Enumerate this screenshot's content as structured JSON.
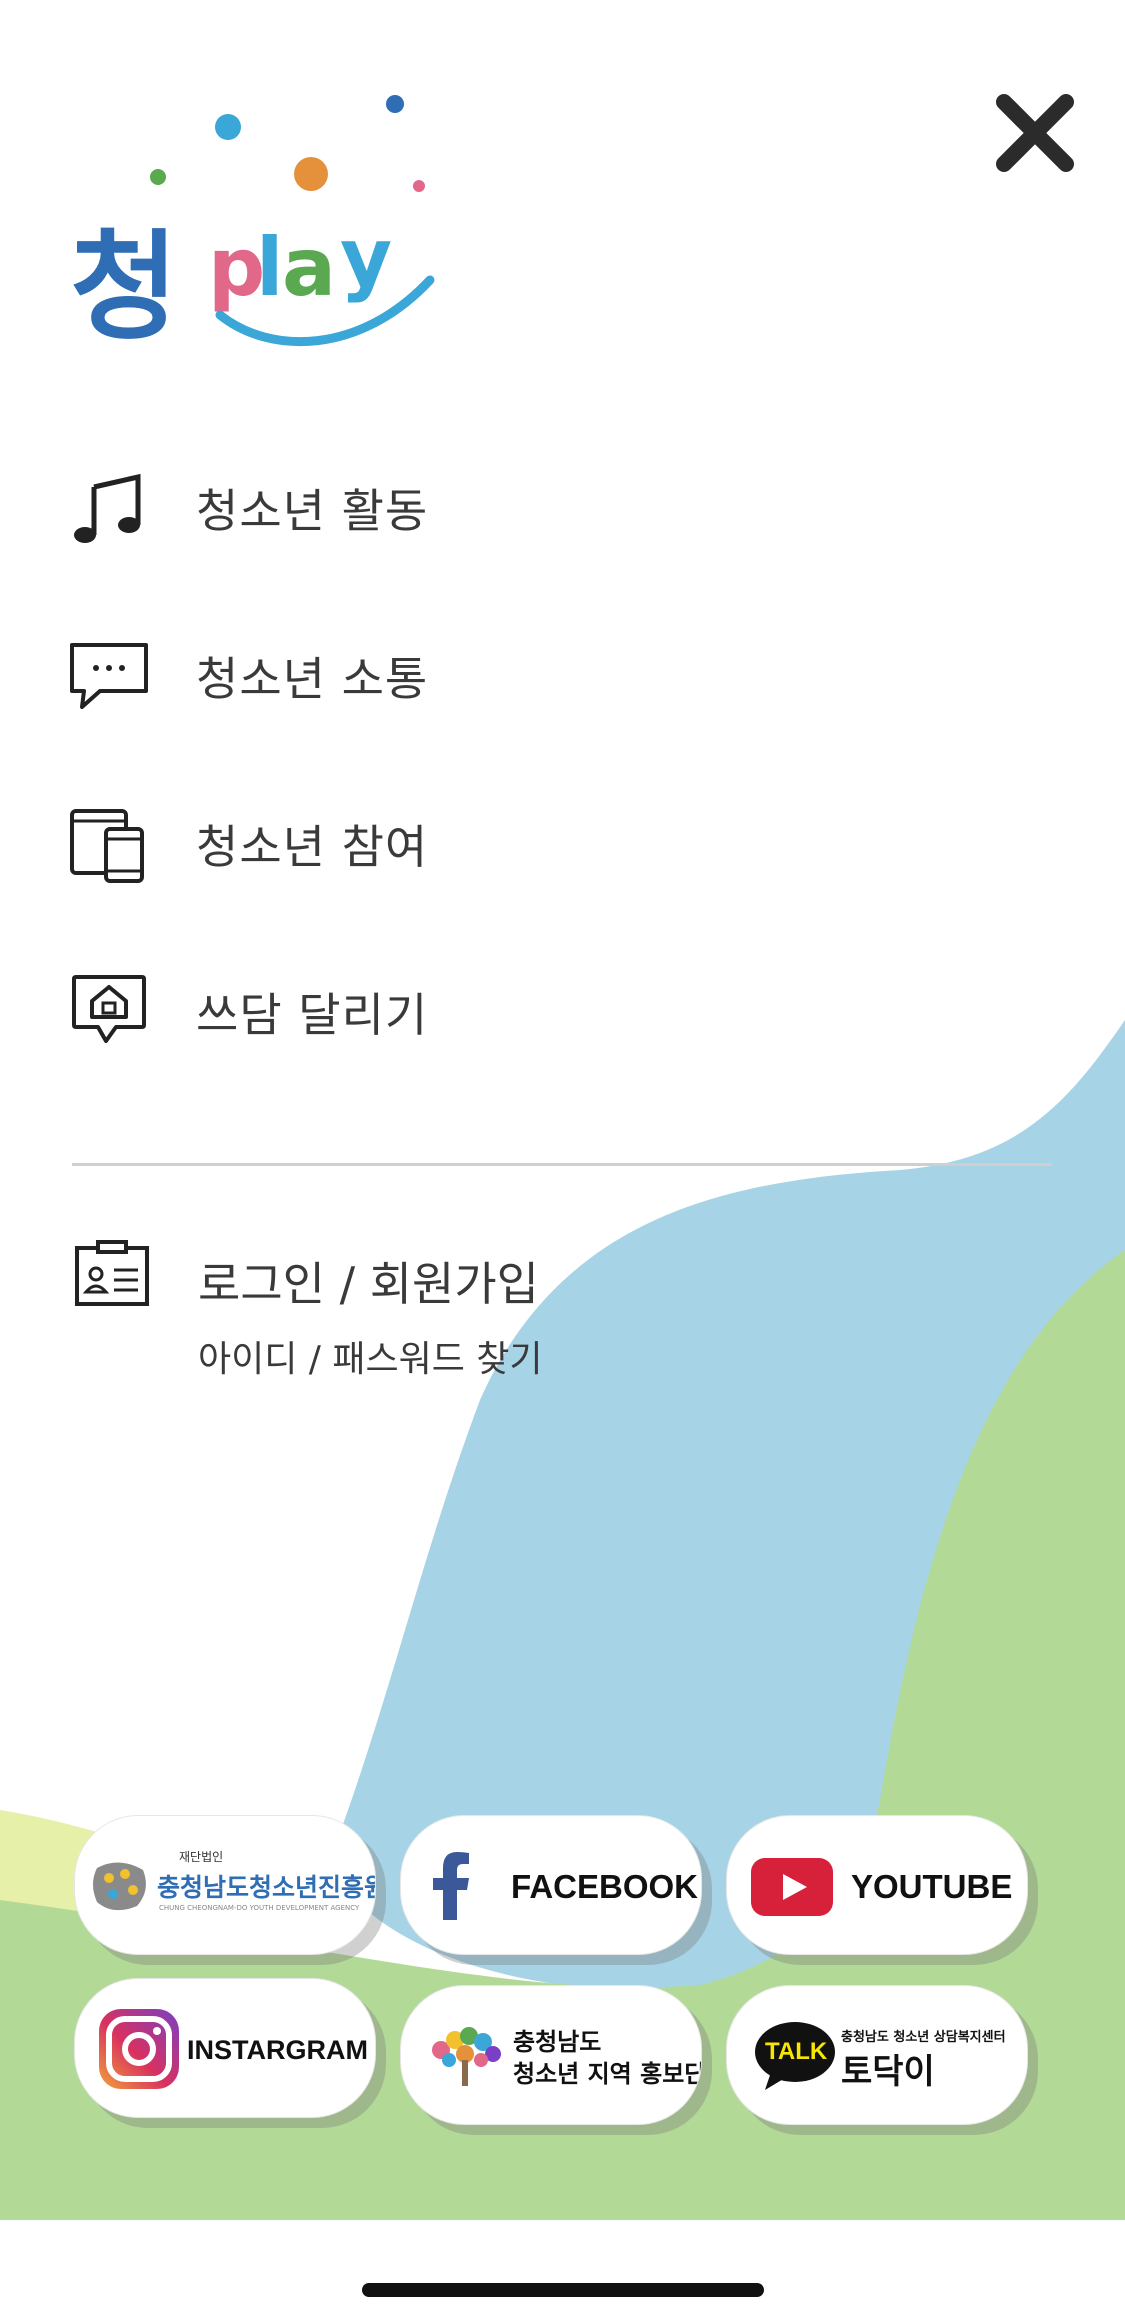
{
  "logo": {
    "text_hangul": "청",
    "text_latin": "play",
    "colors": {
      "blue": "#2f6db4",
      "pink": "#e2688a",
      "orange": "#e5913b",
      "green": "#5aa84f",
      "cyan": "#3aa7d8"
    }
  },
  "menu": {
    "items": [
      {
        "label": "청소년 활동",
        "icon": "music-note-icon"
      },
      {
        "label": "청소년 소통",
        "icon": "chat-bubble-icon"
      },
      {
        "label": "청소년 참여",
        "icon": "devices-icon"
      },
      {
        "label": "쓰담 달리기",
        "icon": "home-bubble-icon"
      }
    ]
  },
  "account": {
    "login_label": "로그인 / 회원가입",
    "find_label": "아이디 / 패스워드 찾기",
    "icon": "id-card-icon"
  },
  "links": {
    "agency": {
      "tag": "재단법인",
      "name": "충청남도청소년진흥원",
      "english": "CHUNG CHEONGNAM-DO YOUTH DEVELOPMENT AGENCY"
    },
    "facebook": {
      "label": "FACEBOOK",
      "color": "#3b5998"
    },
    "youtube": {
      "label": "YOUTUBE",
      "color": "#d7213b"
    },
    "instagram": {
      "label": "INSTARGRAM"
    },
    "promo": {
      "line1": "충청남도",
      "line2": "청소년 지역 홍보단"
    },
    "todak": {
      "badge": "TALK",
      "sub": "충청남도 청소년 상담복지센터",
      "name": "토닥이"
    }
  },
  "colors": {
    "wave_blue": "#a6d4e6",
    "wave_green": "#b2da96",
    "wave_lime": "#e6f0a8"
  }
}
